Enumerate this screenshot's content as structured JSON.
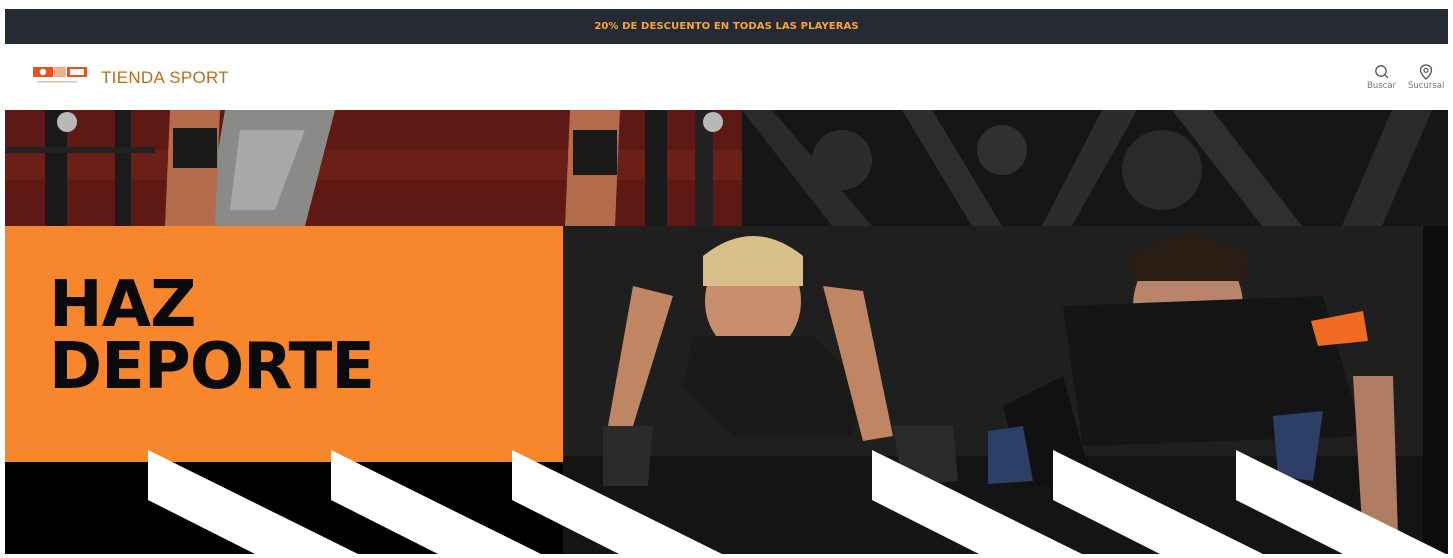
{
  "announcement": {
    "text": "20% DE DESCUENTO EN TODAS LAS PLAYERAS"
  },
  "header": {
    "brand": "TIENDA SPORT",
    "logo_icon": "soccer-ball-icon",
    "actions": [
      {
        "label": "Buscar",
        "icon": "search-icon"
      },
      {
        "label": "Sucursal",
        "icon": "location-pin-icon"
      }
    ]
  },
  "hero": {
    "headline_line1": "HAZ",
    "headline_line2": "DEPORTE"
  },
  "colors": {
    "announcement_bg": "#262b33",
    "announcement_text": "#f7a53a",
    "brand": "#b96e1e",
    "hero_orange": "#f7862c"
  }
}
